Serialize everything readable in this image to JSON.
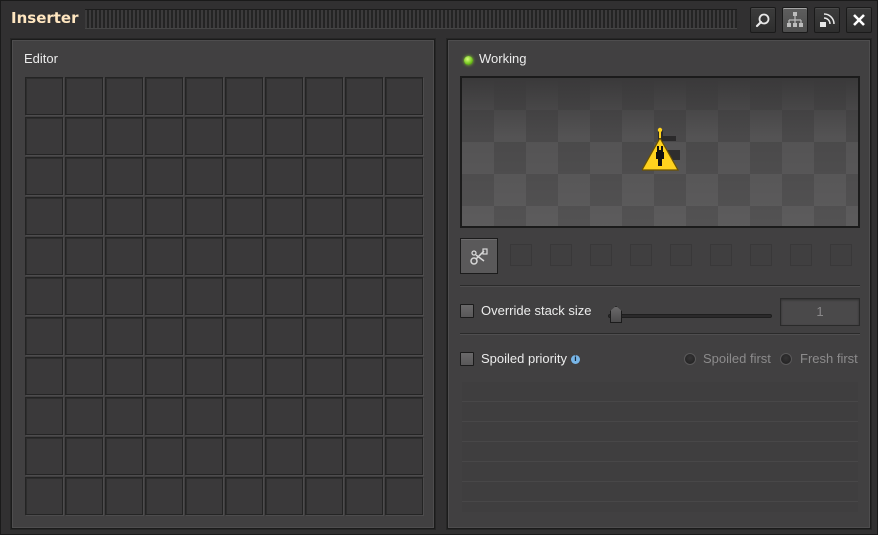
{
  "window": {
    "title": "Inserter"
  },
  "toolbar": {
    "buttons": [
      {
        "icon": "search-icon"
      },
      {
        "icon": "network-icon"
      },
      {
        "icon": "wireless-icon"
      },
      {
        "icon": "close-icon"
      }
    ]
  },
  "editor": {
    "label": "Editor",
    "grid_columns": 10,
    "grid_rows": 11
  },
  "status": {
    "text": "Working",
    "color": "#6ec21b"
  },
  "preview": {
    "entity_icon": "warning-icon"
  },
  "filters": {
    "button_icon": "filter-icon",
    "slot_count": 9
  },
  "override_stack": {
    "label": "Override stack size",
    "checked": false,
    "value": "1"
  },
  "spoiled": {
    "label": "Spoiled priority",
    "info_icon": "info-icon",
    "checked": false,
    "options": [
      {
        "label": "Spoiled first",
        "selected": false
      },
      {
        "label": "Fresh first",
        "selected": false
      }
    ]
  },
  "colors": {
    "title": "#ffe6c0",
    "panel": "#414041",
    "window": "#313031"
  }
}
